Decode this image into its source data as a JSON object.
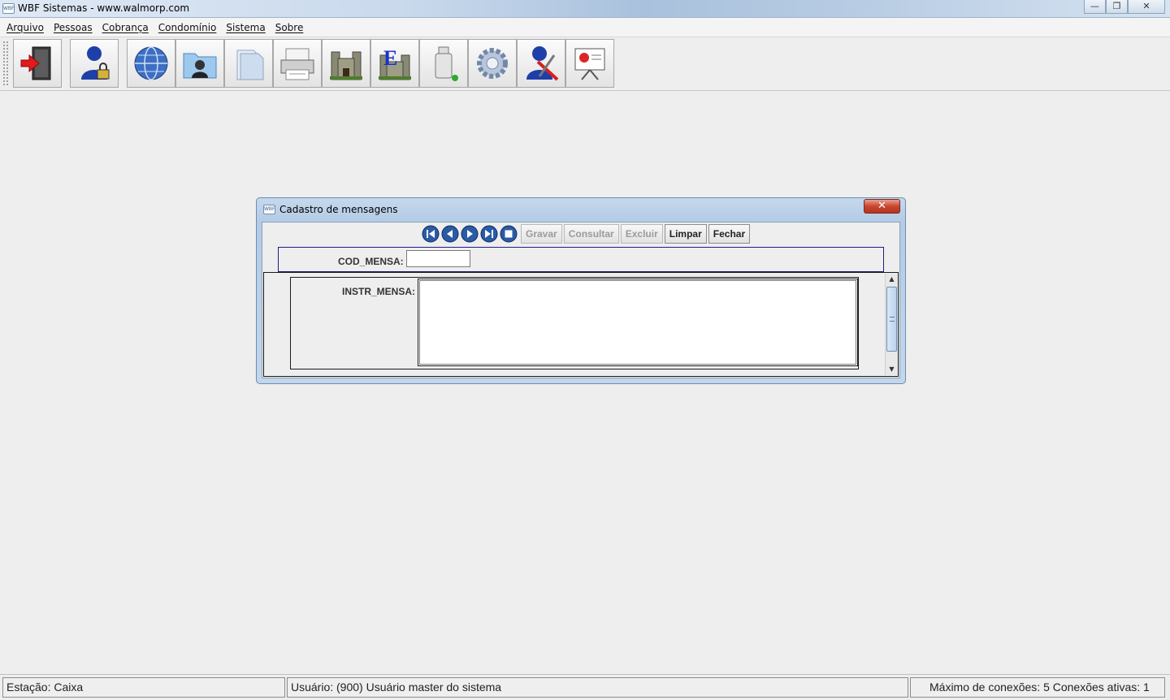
{
  "window": {
    "title": "WBF Sistemas - www.walmorp.com",
    "icon_text": "WBF",
    "minimize_glyph": "—",
    "maximize_glyph": "❐",
    "close_glyph": "✕"
  },
  "menu": {
    "items": [
      "Arquivo",
      "Pessoas",
      "Cobrança",
      "Condomínio",
      "Sistema",
      "Sobre"
    ]
  },
  "toolbar": {
    "buttons": [
      {
        "icon": "exit-door-icon"
      },
      {
        "icon": "user-lock-icon"
      },
      {
        "icon": "globe-icon"
      },
      {
        "icon": "contacts-folder-icon"
      },
      {
        "icon": "folder-icon"
      },
      {
        "icon": "printer-icon"
      },
      {
        "icon": "castle-icon"
      },
      {
        "icon": "castle-e-icon",
        "letter": "E"
      },
      {
        "icon": "usb-drive-icon"
      },
      {
        "icon": "gear-icon"
      },
      {
        "icon": "user-tools-icon"
      },
      {
        "icon": "presentation-board-icon"
      }
    ]
  },
  "dialog": {
    "title": "Cadastro de mensagens",
    "icon_text": "WBF",
    "close_glyph": "✕",
    "nav_buttons": [
      "first-record-icon",
      "previous-record-icon",
      "next-record-icon",
      "last-record-icon",
      "stop-icon"
    ],
    "actions": [
      {
        "label": "Gravar",
        "enabled": false
      },
      {
        "label": "Consultar",
        "enabled": false
      },
      {
        "label": "Excluir",
        "enabled": false
      },
      {
        "label": "Limpar",
        "enabled": true
      },
      {
        "label": "Fechar",
        "enabled": true
      }
    ],
    "fields": {
      "cod_label": "COD_MENSA:",
      "cod_value": "",
      "instr_label": "INSTR_MENSA:",
      "instr_value": ""
    }
  },
  "status": {
    "station": "Estação: Caixa",
    "user": "Usuário: (900) Usuário master do sistema",
    "connections": "Máximo de conexões: 5 Conexões ativas: 1"
  },
  "colors": {
    "nav_blue": "#2b5aa6",
    "panel_border": "#1c1c86",
    "close_red": "#c9462f"
  }
}
